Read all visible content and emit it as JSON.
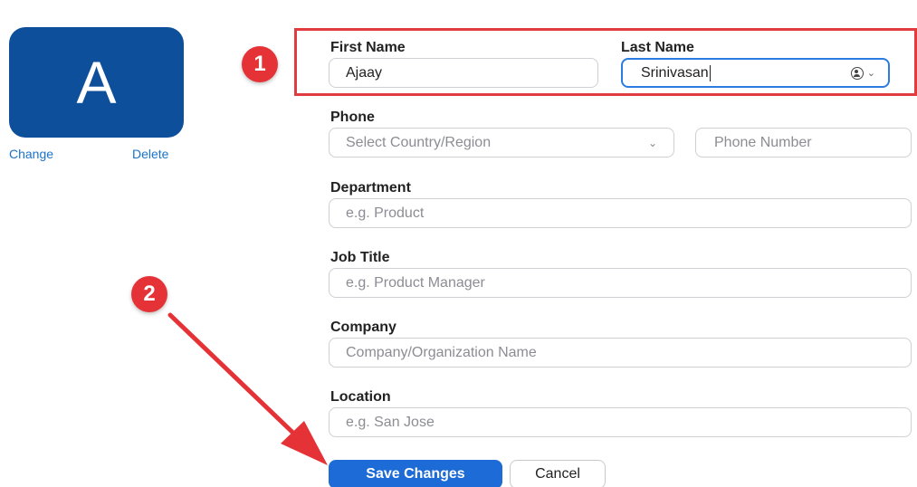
{
  "avatar": {
    "initial": "A",
    "color": "#0e4f9b",
    "change_label": "Change",
    "delete_label": "Delete"
  },
  "annotations": {
    "step1": "1",
    "step2": "2",
    "accent": "#e53236"
  },
  "form": {
    "first_name": {
      "label": "First Name",
      "value": "Ajaay"
    },
    "last_name": {
      "label": "Last Name",
      "value": "Srinivasan",
      "trail_icon": "contact-card-icon"
    },
    "phone": {
      "label": "Phone",
      "country_placeholder": "Select Country/Region",
      "number_placeholder": "Phone Number"
    },
    "department": {
      "label": "Department",
      "placeholder": "e.g. Product"
    },
    "job_title": {
      "label": "Job Title",
      "placeholder": "e.g. Product Manager"
    },
    "company": {
      "label": "Company",
      "placeholder": "Company/Organization Name"
    },
    "location": {
      "label": "Location",
      "placeholder": "e.g. San Jose"
    }
  },
  "actions": {
    "save_label": "Save Changes",
    "cancel_label": "Cancel",
    "save_color": "#1c6bd6"
  }
}
